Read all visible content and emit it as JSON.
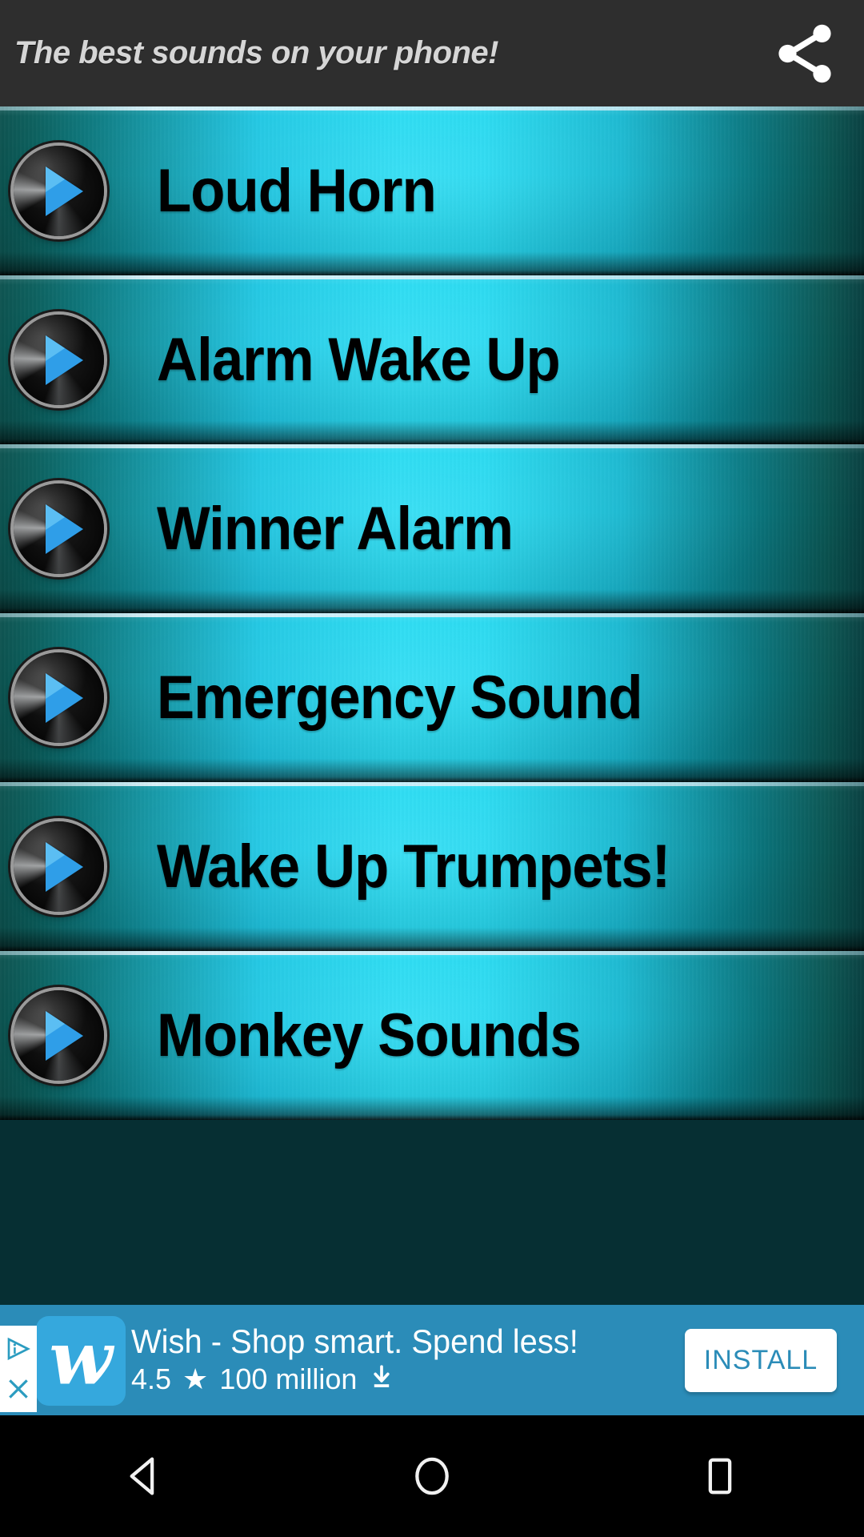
{
  "header": {
    "title": "The best sounds on your phone!",
    "share_icon": "share-icon"
  },
  "sound_list": {
    "items": [
      {
        "label": "Loud Horn",
        "play_icon": "play-icon"
      },
      {
        "label": "Alarm Wake Up",
        "play_icon": "play-icon"
      },
      {
        "label": "Winner Alarm",
        "play_icon": "play-icon"
      },
      {
        "label": "Emergency Sound",
        "play_icon": "play-icon"
      },
      {
        "label": "Wake Up Trumpets!",
        "play_icon": "play-icon"
      },
      {
        "label": "Monkey Sounds",
        "play_icon": "play-icon"
      }
    ]
  },
  "ad": {
    "app_icon_letter": "w",
    "headline": "Wish - Shop smart. Spend less!",
    "rating": "4.5",
    "star_glyph": "★",
    "installs": "100 million",
    "download_glyph": "⬇",
    "install_label": "INSTALL",
    "adchoices_info_icon": "adchoices-info-icon",
    "adchoices_close_icon": "close-icon"
  },
  "nav_bar": {
    "back_label": "back-icon",
    "home_label": "home-icon",
    "recents_label": "recents-icon"
  },
  "colors": {
    "header_bg": "#2e2e2e",
    "header_text": "#d6d6d6",
    "item_center": "#17d9f2",
    "item_edge": "#0b524f",
    "item_text": "#000000",
    "ad_bg": "#2b8cb8",
    "ad_accent": "#35a8dd",
    "install_text": "#2b8cb8",
    "nav_bg": "#000000"
  }
}
